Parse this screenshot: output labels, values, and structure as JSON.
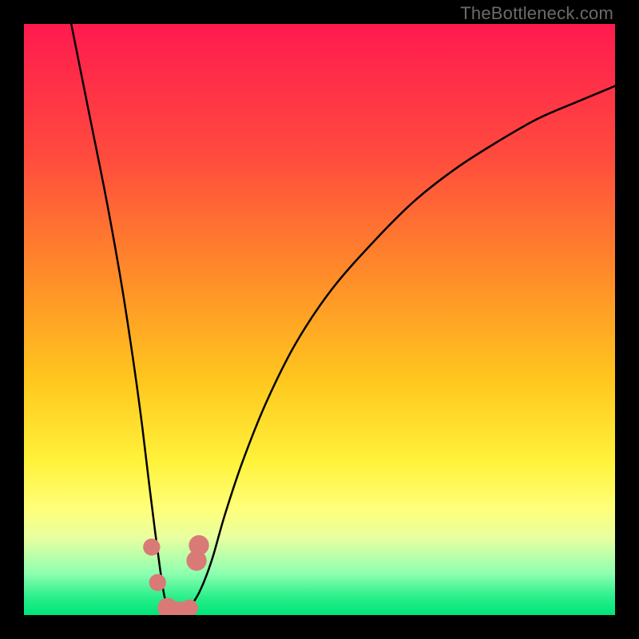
{
  "watermark": "TheBottleneck.com",
  "chart_data": {
    "type": "line",
    "title": "",
    "xlabel": "",
    "ylabel": "",
    "xlim": [
      0,
      100
    ],
    "ylim": [
      0,
      100
    ],
    "grid": false,
    "legend": false,
    "gradient_stops": [
      {
        "offset": 0.0,
        "color": "#ff1a4f"
      },
      {
        "offset": 0.22,
        "color": "#ff4a3e"
      },
      {
        "offset": 0.42,
        "color": "#ff8a2a"
      },
      {
        "offset": 0.6,
        "color": "#ffc61e"
      },
      {
        "offset": 0.74,
        "color": "#fff23a"
      },
      {
        "offset": 0.82,
        "color": "#ffff7a"
      },
      {
        "offset": 0.87,
        "color": "#e8ffa0"
      },
      {
        "offset": 0.93,
        "color": "#8cffb0"
      },
      {
        "offset": 0.97,
        "color": "#29ef8a"
      },
      {
        "offset": 1.0,
        "color": "#00e47a"
      }
    ],
    "series": [
      {
        "name": "bottleneck-curve",
        "color": "#000000",
        "x": [
          8.0,
          11.0,
          14.0,
          16.5,
          18.5,
          20.0,
          21.2,
          22.2,
          23.0,
          23.7,
          24.4,
          25.2,
          26.4,
          27.8,
          29.2,
          30.6,
          32.0,
          34.0,
          37.0,
          41.0,
          46.0,
          52.0,
          59.0,
          66.0,
          73.0,
          80.0,
          87.0,
          94.0,
          100.0
        ],
        "values": [
          100.0,
          85.0,
          70.0,
          56.0,
          43.0,
          32.0,
          22.0,
          14.0,
          8.0,
          3.5,
          1.0,
          0.3,
          0.5,
          1.2,
          3.0,
          6.0,
          10.0,
          17.0,
          26.0,
          36.0,
          46.0,
          55.0,
          63.0,
          70.0,
          75.5,
          80.0,
          84.0,
          87.0,
          89.5
        ]
      }
    ],
    "markers": [
      {
        "name": "dot-left-upper",
        "x": 21.6,
        "y": 11.5,
        "r": 1.0,
        "color": "#d97a77"
      },
      {
        "name": "dot-left-lower",
        "x": 22.6,
        "y": 5.5,
        "r": 1.0,
        "color": "#d97a77"
      },
      {
        "name": "dot-bottom-a",
        "x": 24.3,
        "y": 1.2,
        "r": 1.3,
        "color": "#d97a77"
      },
      {
        "name": "dot-bottom-b",
        "x": 26.2,
        "y": 0.6,
        "r": 1.3,
        "color": "#d97a77"
      },
      {
        "name": "dot-bottom-c",
        "x": 28.0,
        "y": 1.2,
        "r": 1.0,
        "color": "#d97a77"
      },
      {
        "name": "dot-right-a",
        "x": 29.2,
        "y": 9.2,
        "r": 1.3,
        "color": "#d97a77"
      },
      {
        "name": "dot-right-b",
        "x": 29.6,
        "y": 11.8,
        "r": 1.3,
        "color": "#d97a77"
      }
    ]
  }
}
